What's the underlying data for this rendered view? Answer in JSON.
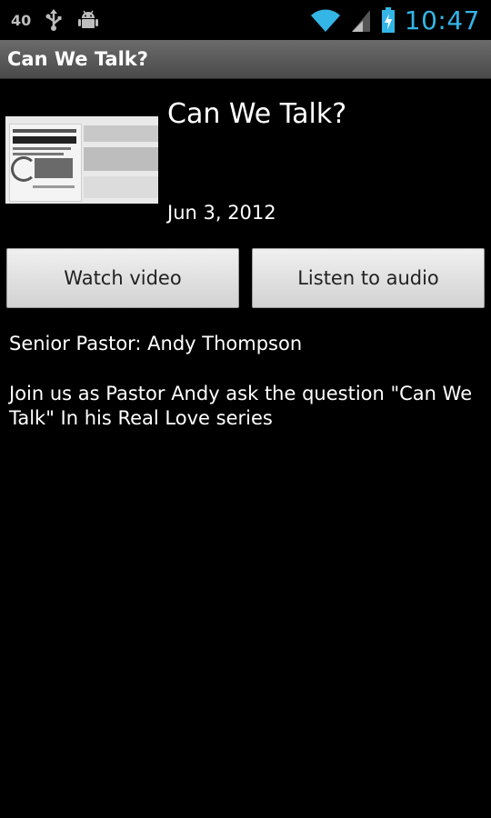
{
  "status_bar": {
    "notification_count": "40",
    "time": "10:47",
    "icons": [
      "usb-icon",
      "android-debug-icon",
      "wifi-icon",
      "signal-icon",
      "battery-charging-icon"
    ],
    "clock_color": "#33b5e5"
  },
  "app": {
    "title": "Can We Talk?"
  },
  "sermon": {
    "title": "Can We Talk?",
    "date": "Jun 3, 2012",
    "thumbnail_icon": "sermon-thumbnail-image",
    "watch_label": "Watch video",
    "listen_label": "Listen to audio",
    "pastor": "Senior Pastor: Andy Thompson",
    "description": "Join us as Pastor Andy ask the question \"Can We Talk\" In his Real Love series"
  }
}
